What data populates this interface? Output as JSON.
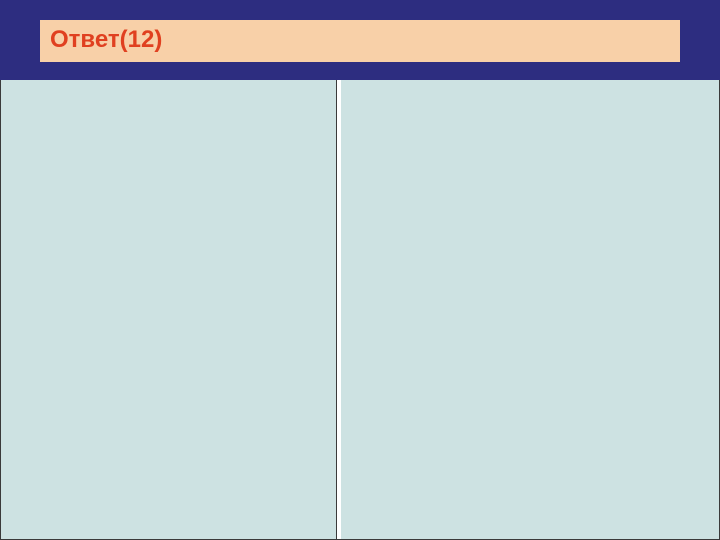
{
  "header": {
    "title": "Ответ(12)"
  }
}
